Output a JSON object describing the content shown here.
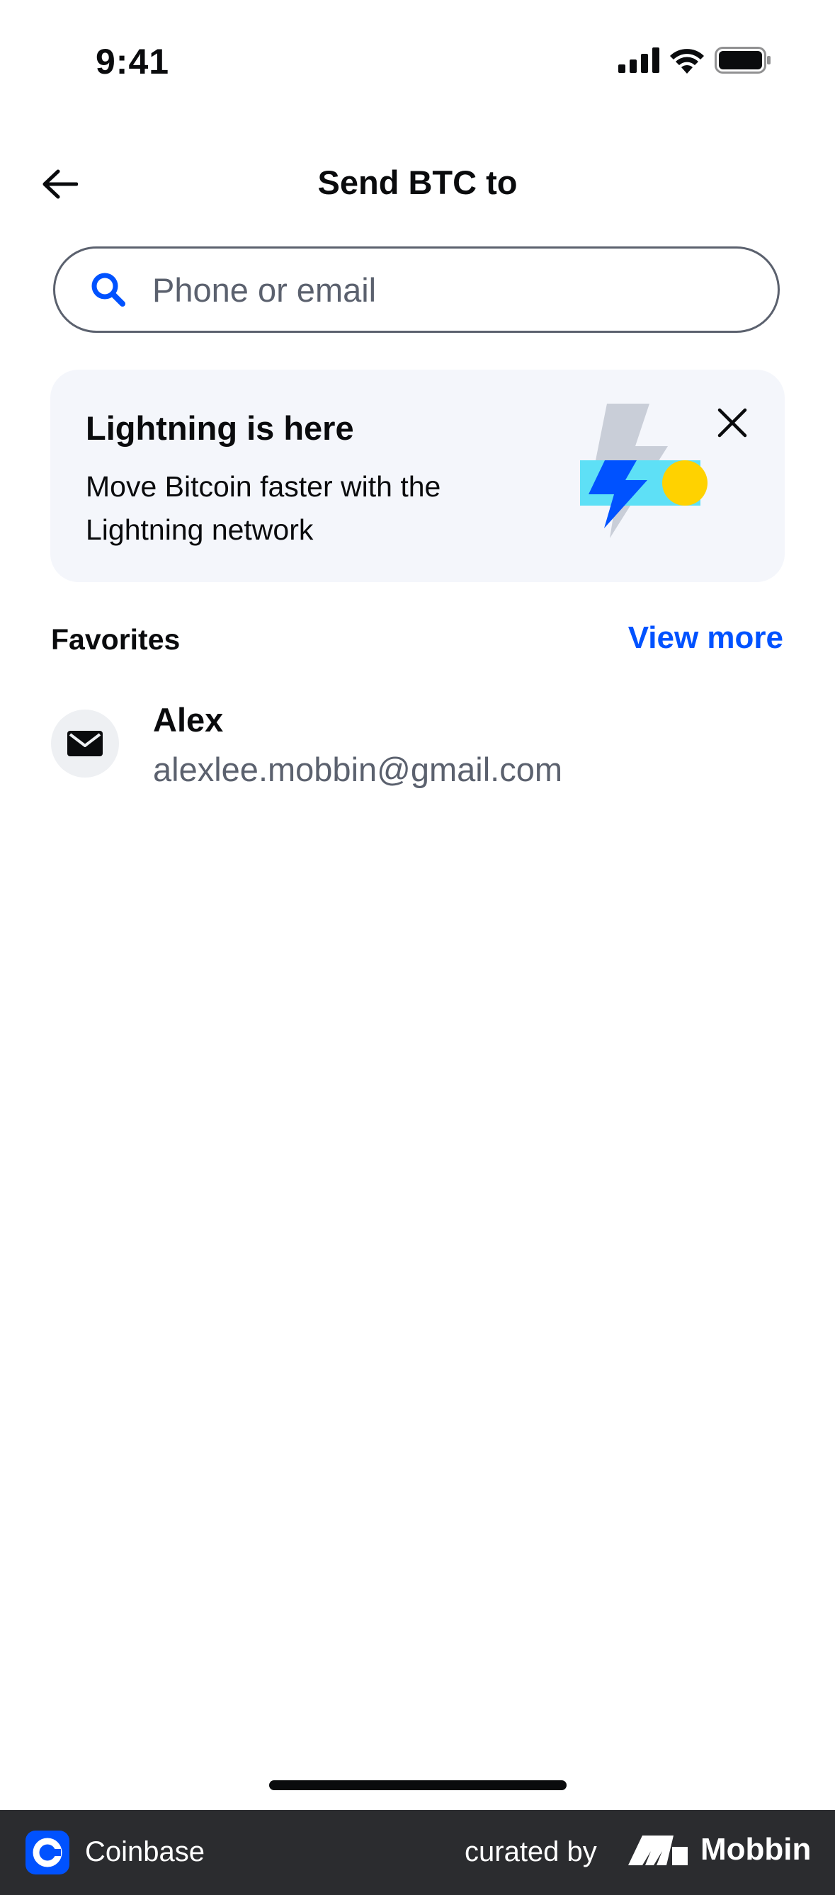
{
  "status_bar": {
    "time": "9:41"
  },
  "nav": {
    "title": "Send BTC to"
  },
  "search": {
    "placeholder": "Phone or email"
  },
  "promo": {
    "title": "Lightning is here",
    "text": "Move Bitcoin faster with the Lightning network"
  },
  "favorites": {
    "title": "Favorites",
    "view_more": "View more",
    "items": [
      {
        "name": "Alex",
        "email": "alexlee.mobbin@gmail.com"
      }
    ]
  },
  "footer": {
    "app_name": "Coinbase",
    "curated_by": "curated by",
    "brand": "Mobbin"
  },
  "colors": {
    "accent": "#0052ff",
    "promo_bg": "#f4f6fb",
    "secondary_text": "#5b616e",
    "footer_bg": "#2b2c2f"
  }
}
